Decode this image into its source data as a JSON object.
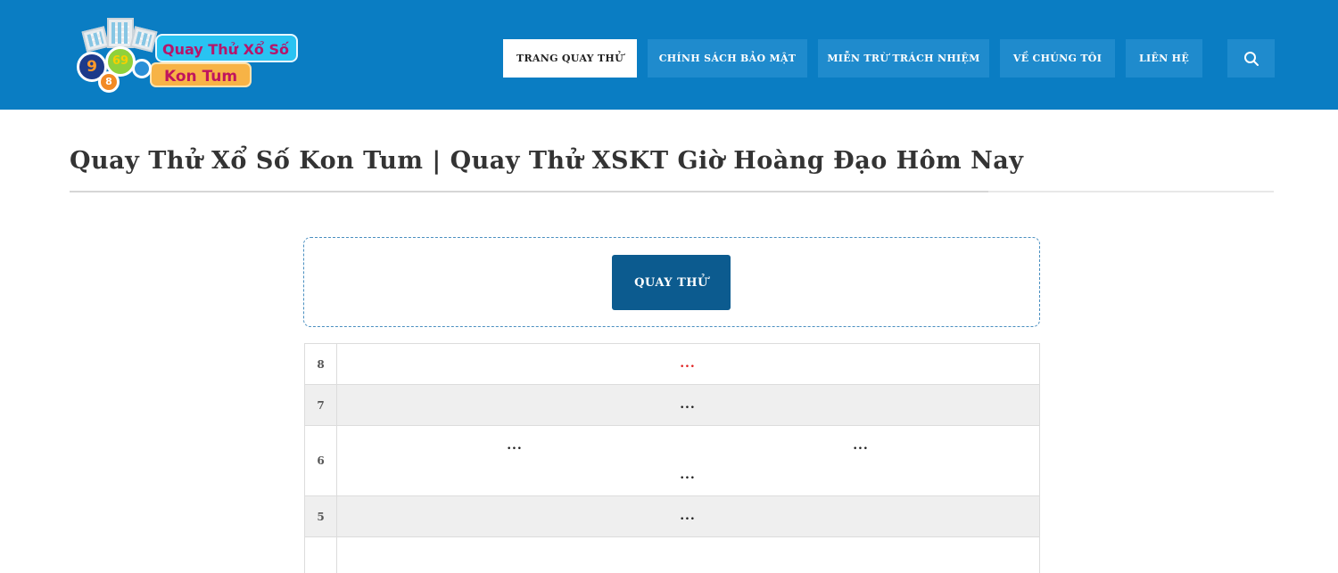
{
  "header": {
    "logo": {
      "line1": "Quay Thử Xổ Số",
      "line2": "Kon Tum",
      "balls": [
        "9",
        "69",
        "8"
      ]
    },
    "nav": [
      {
        "label": "TRANG QUAY THỬ",
        "active": true
      },
      {
        "label": "CHÍNH SÁCH BẢO MẬT",
        "active": false
      },
      {
        "label": "MIỄN TRỪ TRÁCH NHIỆM",
        "active": false
      },
      {
        "label": "VỀ CHÚNG TÔI",
        "active": false
      },
      {
        "label": "LIÊN HỆ",
        "active": false
      }
    ],
    "search_icon": "search-icon"
  },
  "main": {
    "title": "Quay Thử Xổ Số Kon Tum | Quay Thử XSKT Giờ Hoàng Đạo Hôm Nay",
    "spin_label": "QUAY THỬ",
    "results": [
      {
        "prize": "8",
        "values": [
          "..."
        ]
      },
      {
        "prize": "7",
        "values": [
          "..."
        ]
      },
      {
        "prize": "6",
        "values": [
          "...",
          "...",
          "..."
        ]
      },
      {
        "prize": "5",
        "values": [
          "..."
        ]
      },
      {
        "prize": "",
        "values": []
      }
    ]
  },
  "colors": {
    "header_bg": "#0a7dc3",
    "nav_bg": "#1f8bcd",
    "button_bg": "#0c5b8f",
    "prize8_color": "#e02020"
  }
}
